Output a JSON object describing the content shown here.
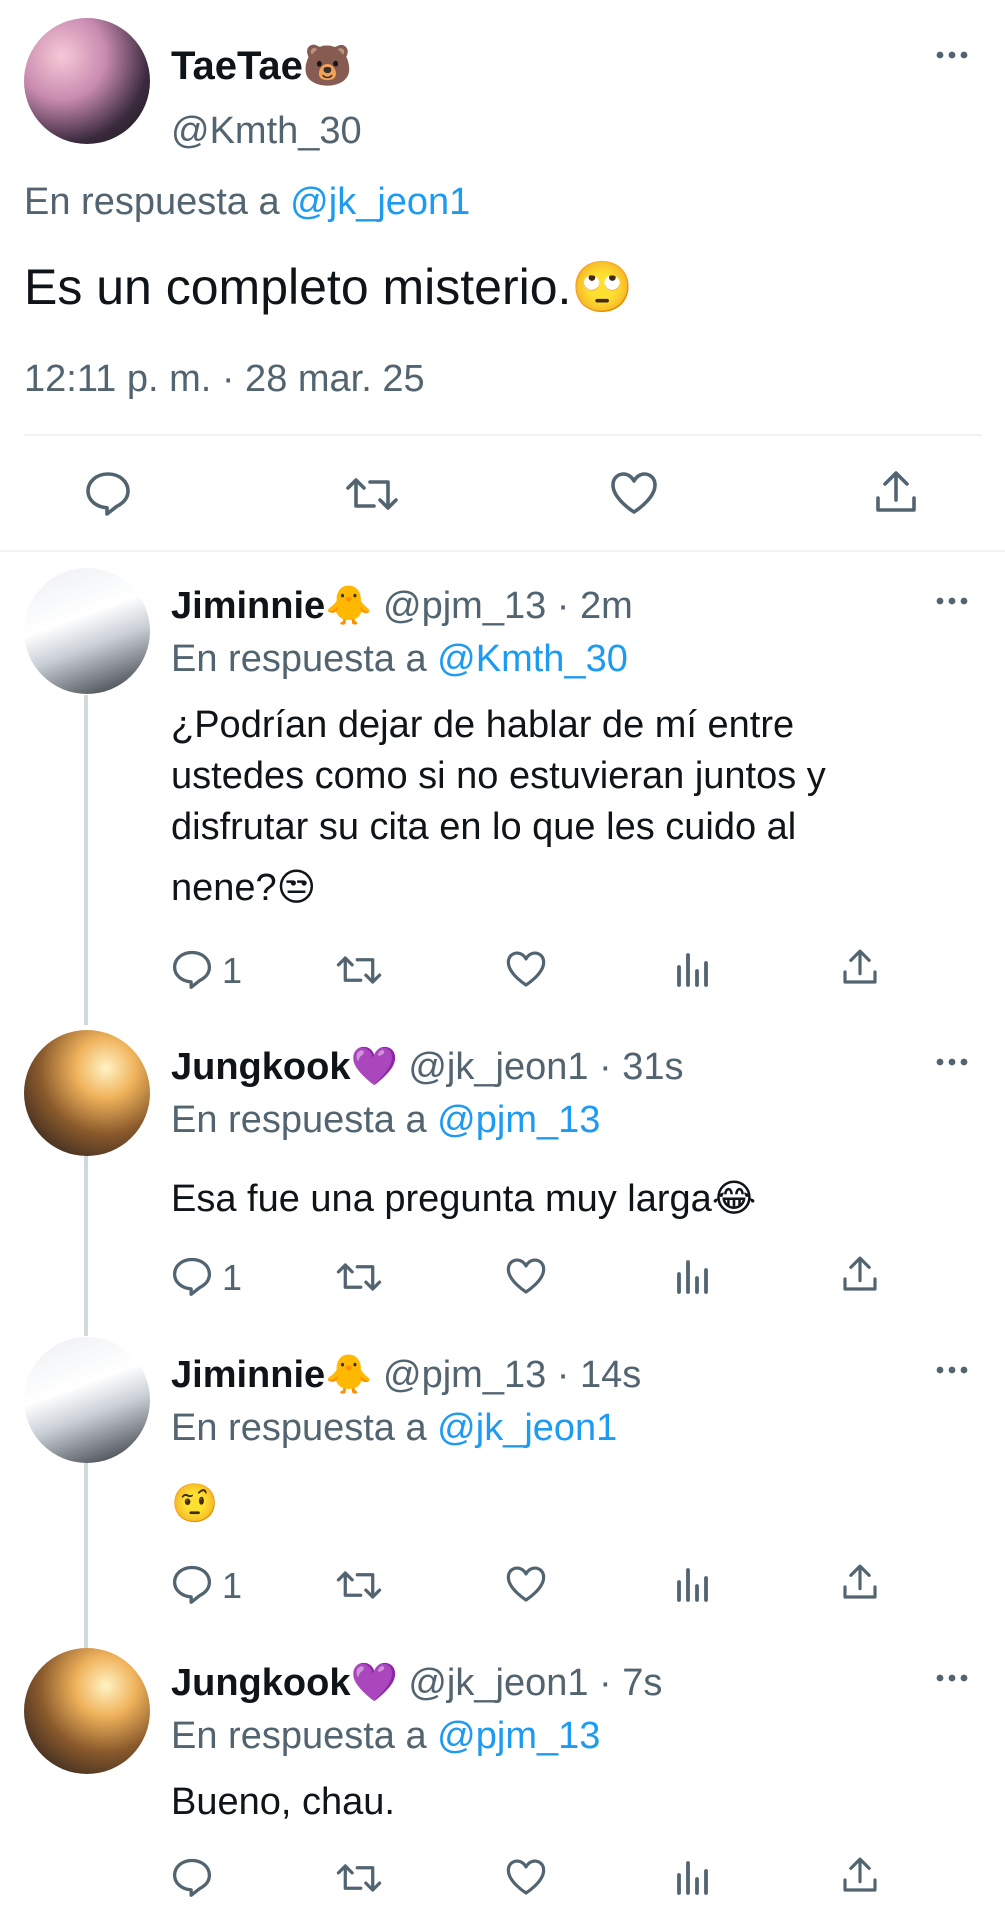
{
  "main_tweet": {
    "display_name": "TaeTae🐻",
    "handle": "@Kmth_30",
    "reply_prefix": "En respuesta a",
    "reply_to": "@jk_jeon1",
    "text": "Es un completo misterio.🙄",
    "timestamp": "12:11 p. m. · 28 mar. 25"
  },
  "replies": [
    {
      "display_name": "Jiminnie🐥",
      "meta": "@pjm_13 · 2m",
      "reply_prefix": "En respuesta a",
      "reply_to": "@Kmth_30",
      "text_lines": [
        "¿Podrían dejar de hablar de mí entre",
        "ustedes como si no estuvieran juntos y",
        "disfrutar su cita en lo que les cuido al",
        "nene?😒"
      ],
      "reply_count": "1"
    },
    {
      "display_name": "Jungkook💜",
      "meta": "@jk_jeon1 · 31s",
      "reply_prefix": "En respuesta a",
      "reply_to": "@pjm_13",
      "text": "Esa fue una pregunta muy larga😂",
      "reply_count": "1"
    },
    {
      "display_name": "Jiminnie🐥",
      "meta": "@pjm_13 · 14s",
      "reply_prefix": "En respuesta a",
      "reply_to": "@jk_jeon1",
      "text": "🤨",
      "reply_count": "1"
    },
    {
      "display_name": "Jungkook💜",
      "meta": "@jk_jeon1 · 7s",
      "reply_prefix": "En respuesta a",
      "reply_to": "@pjm_13",
      "text": "Bueno, chau.",
      "reply_count": ""
    }
  ],
  "colors": {
    "link": "#1d9bf0",
    "secondary": "#536471",
    "thread_line": "#cfd9de"
  },
  "icons": [
    "more-icon",
    "reply-icon",
    "retweet-icon",
    "like-icon",
    "views-icon",
    "share-icon"
  ]
}
